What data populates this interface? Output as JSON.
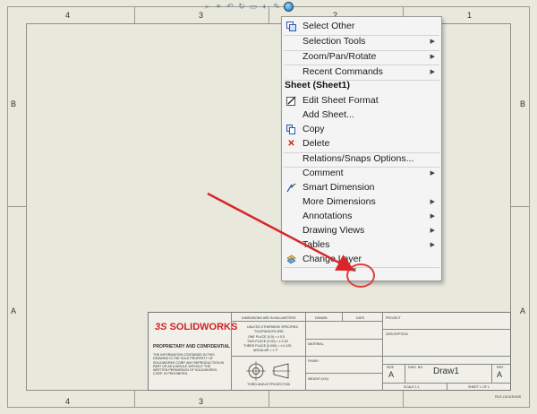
{
  "zones": {
    "top": [
      "4",
      "3",
      "2",
      "1"
    ],
    "bottom": [
      "4",
      "3"
    ],
    "left": [
      "B",
      "A"
    ],
    "right": [
      "B",
      "A"
    ]
  },
  "menu": {
    "items_top": [
      {
        "label": "Select Other",
        "icon": "select-other-icon",
        "submenu": false
      },
      {
        "label": "Selection Tools",
        "submenu": true
      },
      {
        "label": "Zoom/Pan/Rotate",
        "submenu": true
      },
      {
        "label": "Recent Commands",
        "submenu": true
      }
    ],
    "section_title": "Sheet (Sheet1)",
    "items_sheet": [
      {
        "label": "Edit Sheet Format",
        "icon": "edit-sheet-format-icon",
        "submenu": false
      },
      {
        "label": "Add Sheet...",
        "submenu": false
      },
      {
        "label": "Copy",
        "icon": "copy-icon",
        "submenu": false
      },
      {
        "label": "Delete",
        "icon": "delete-icon",
        "submenu": false
      }
    ],
    "relations": "Relations/Snaps Options...",
    "items_bottom": [
      {
        "label": "Comment",
        "submenu": true
      },
      {
        "label": "Smart Dimension",
        "icon": "smart-dimension-icon",
        "submenu": false
      },
      {
        "label": "More Dimensions",
        "submenu": true
      },
      {
        "label": "Annotations",
        "submenu": true
      },
      {
        "label": "Drawing Views",
        "submenu": true
      },
      {
        "label": "Tables",
        "submenu": true
      },
      {
        "label": "Change Layer",
        "icon": "change-layer-icon",
        "submenu": false
      }
    ],
    "expand": "»"
  },
  "title_block": {
    "logo": "SOLIDWORKS",
    "proprietary": "PROPRIETARY AND CONFIDENTIAL",
    "prop_text": "THE INFORMATION CONTAINED IN THIS DRAWING IS THE SOLE PROPERTY OF SOLIDWORKS CORP. ANY REPRODUCTION IN PART OR AS A WHOLE WITHOUT THE WRITTEN PERMISSION OF SOLIDWORKS CORP. IS PROHIBITED.",
    "dims": "DIMENSIONS ARE IN MILLIMETERS",
    "tolerances": [
      "UNLESS OTHERWISE SPECIFIED",
      "TOLERANCES ARE:",
      "ONE PLACE (0.0) = ± 0.5",
      "TWO PLACE (0.00) = ± 0.25",
      "THREE PLACE (0.000) = ± 0.125",
      "ANGULAR = ± 1°"
    ],
    "drawn": "DRAWN",
    "checked": "CHECKED",
    "date": "DATE",
    "project": "PROJECT",
    "description": "DESCRIPTION",
    "material": "MATERIAL",
    "finish": "FINISH",
    "weight": "WEIGHT (KG)",
    "projection": "THIRD ANGLE PROJECTION",
    "size": "SIZE",
    "dwg_no": "DWG. NO.",
    "rev": "REV",
    "size_val": "A",
    "rev_val": "A",
    "drawing": "Draw1",
    "scale": "SCALE 1:1",
    "sheet": "SHEET 1 OF 1",
    "file_locations": "FILE LOCATIONS"
  }
}
